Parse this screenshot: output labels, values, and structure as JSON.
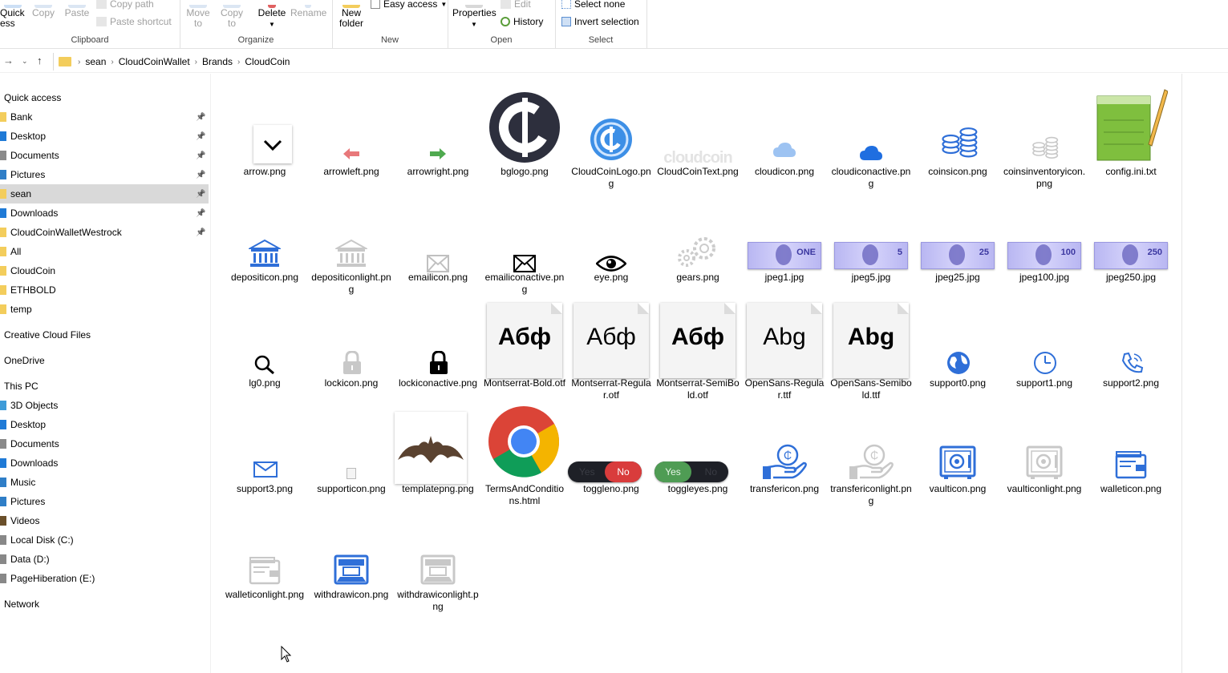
{
  "ribbon": {
    "clipboard": {
      "label": "Clipboard",
      "quick_access": "Quick\ness",
      "copy": "Copy",
      "paste": "Paste",
      "copy_path": "Copy path",
      "paste_shortcut": "Paste shortcut"
    },
    "organize": {
      "label": "Organize",
      "move_to": "Move\nto",
      "copy_to": "Copy\nto",
      "delete": "Delete",
      "rename": "Rename"
    },
    "new": {
      "label": "New",
      "new_folder": "New\nfolder",
      "easy_access": "Easy access"
    },
    "open": {
      "label": "Open",
      "properties": "Properties",
      "edit": "Edit",
      "history": "History"
    },
    "select": {
      "label": "Select",
      "select_none": "Select none",
      "invert_selection": "Invert selection"
    }
  },
  "address": {
    "crumbs": [
      "sean",
      "CloudCoinWallet",
      "Brands",
      "CloudCoin"
    ]
  },
  "sidebar": {
    "items": [
      {
        "label": "Quick access",
        "type": "header"
      },
      {
        "label": "Bank",
        "pinned": true,
        "icon_color": "#f3cd5c"
      },
      {
        "label": "Desktop",
        "pinned": true,
        "icon_color": "#1f7ad6"
      },
      {
        "label": "Documents",
        "pinned": true,
        "icon_color": "#8a8a8a"
      },
      {
        "label": "Pictures",
        "pinned": true,
        "icon_color": "#2f7ec7"
      },
      {
        "label": "sean",
        "pinned": true,
        "selected": true,
        "icon_color": "#f3cd5c"
      },
      {
        "label": "Downloads",
        "pinned": true,
        "icon_color": "#1f7ad6"
      },
      {
        "label": "CloudCoinWalletWestrock",
        "pinned": true,
        "icon_color": "#f3cd5c"
      },
      {
        "label": "All",
        "icon_color": "#f3cd5c"
      },
      {
        "label": "CloudCoin",
        "icon_color": "#f3cd5c"
      },
      {
        "label": "ETHBOLD",
        "icon_color": "#f3cd5c"
      },
      {
        "label": "temp",
        "icon_color": "#f3cd5c"
      },
      {
        "label": "Creative Cloud Files",
        "type": "header"
      },
      {
        "label": "OneDrive",
        "type": "header"
      },
      {
        "label": "This PC",
        "type": "header"
      },
      {
        "label": "3D Objects",
        "icon_color": "#3d9bd8"
      },
      {
        "label": "Desktop",
        "icon_color": "#1f7ad6"
      },
      {
        "label": "Documents",
        "icon_color": "#8a8a8a"
      },
      {
        "label": "Downloads",
        "icon_color": "#1f7ad6"
      },
      {
        "label": "Music",
        "icon_color": "#2f7ec7"
      },
      {
        "label": "Pictures",
        "icon_color": "#2f7ec7"
      },
      {
        "label": "Videos",
        "icon_color": "#6a4f2a"
      },
      {
        "label": "Local Disk (C:)",
        "icon_color": "#888888"
      },
      {
        "label": "Data (D:)",
        "icon_color": "#888888"
      },
      {
        "label": "PageHiberation (E:)",
        "icon_color": "#888888"
      },
      {
        "label": "Network",
        "type": "header"
      }
    ]
  },
  "files": [
    {
      "name": "arrow.png",
      "icon": "chevron-down-icon"
    },
    {
      "name": "arrowleft.png",
      "icon": "arrow-left-icon"
    },
    {
      "name": "arrowright.png",
      "icon": "arrow-right-icon"
    },
    {
      "name": "bglogo.png",
      "icon": "cloudcoin-dark-logo"
    },
    {
      "name": "CloudCoinLogo.png",
      "icon": "cloudcoin-blue-logo"
    },
    {
      "name": "CloudCoinText.png",
      "icon": "cloudcoin-text-logo",
      "logo_text": "cloudcoin"
    },
    {
      "name": "cloudicon.png",
      "icon": "cloud-light-icon"
    },
    {
      "name": "cloudiconactive.png",
      "icon": "cloud-active-icon"
    },
    {
      "name": "coinsicon.png",
      "icon": "coins-icon"
    },
    {
      "name": "coinsinventoryicon.png",
      "icon": "coins-light-icon"
    },
    {
      "name": "config.ini.txt",
      "icon": "notepad-icon"
    },
    {
      "name": "depositicon.png",
      "icon": "bank-icon"
    },
    {
      "name": "depositiconlight.png",
      "icon": "bank-light-icon"
    },
    {
      "name": "emailicon.png",
      "icon": "email-light-icon"
    },
    {
      "name": "emailiconactive.png",
      "icon": "email-icon"
    },
    {
      "name": "eye.png",
      "icon": "eye-icon"
    },
    {
      "name": "gears.png",
      "icon": "gears-icon"
    },
    {
      "name": "jpeg1.jpg",
      "icon": "banknote-image",
      "note": "ONE"
    },
    {
      "name": "jpeg5.jpg",
      "icon": "banknote-image",
      "note": "5"
    },
    {
      "name": "jpeg25.jpg",
      "icon": "banknote-image",
      "note": "25"
    },
    {
      "name": "jpeg100.jpg",
      "icon": "banknote-image",
      "note": "100"
    },
    {
      "name": "jpeg250.jpg",
      "icon": "banknote-image",
      "note": "250"
    },
    {
      "name": "lg0.png",
      "icon": "magnifier-icon"
    },
    {
      "name": "lockicon.png",
      "icon": "lock-light-icon"
    },
    {
      "name": "lockiconactive.png",
      "icon": "lock-icon"
    },
    {
      "name": "Montserrat-Bold.otf",
      "icon": "font-file-icon",
      "sample": "Абф",
      "weight": "bold"
    },
    {
      "name": "Montserrat-Regular.otf",
      "icon": "font-file-icon",
      "sample": "Абф",
      "weight": "normal"
    },
    {
      "name": "Montserrat-SemiBold.otf",
      "icon": "font-file-icon",
      "sample": "Абф",
      "weight": "600"
    },
    {
      "name": "OpenSans-Regular.ttf",
      "icon": "font-file-icon",
      "sample": "Abg",
      "weight": "normal"
    },
    {
      "name": "OpenSans-Semibold.ttf",
      "icon": "font-file-icon",
      "sample": "Abg",
      "weight": "600"
    },
    {
      "name": "support0.png",
      "icon": "globe-icon"
    },
    {
      "name": "support1.png",
      "icon": "clock-icon"
    },
    {
      "name": "support2.png",
      "icon": "phone-icon"
    },
    {
      "name": "support3.png",
      "icon": "envelope-icon"
    },
    {
      "name": "supporticon.png",
      "icon": "tiny-icon"
    },
    {
      "name": "templatepng.png",
      "icon": "bat-image"
    },
    {
      "name": "TermsAndConditions.html",
      "icon": "chrome-icon"
    },
    {
      "name": "toggleno.png",
      "icon": "toggle-no-image",
      "toggle_on": "Yes",
      "toggle_off": "No"
    },
    {
      "name": "toggleyes.png",
      "icon": "toggle-yes-image",
      "toggle_on": "Yes",
      "toggle_off": "No"
    },
    {
      "name": "transfericon.png",
      "icon": "transfer-icon"
    },
    {
      "name": "transfericonlight.png",
      "icon": "transfer-light-icon"
    },
    {
      "name": "vaulticon.png",
      "icon": "vault-icon"
    },
    {
      "name": "vaulticonlight.png",
      "icon": "vault-light-icon"
    },
    {
      "name": "walleticon.png",
      "icon": "wallet-icon"
    },
    {
      "name": "walleticonlight.png",
      "icon": "wallet-light-icon"
    },
    {
      "name": "withdrawicon.png",
      "icon": "withdraw-icon"
    },
    {
      "name": "withdrawiconlight.png",
      "icon": "withdraw-light-icon"
    }
  ],
  "colors": {
    "accent_blue": "#2f6fd8",
    "selection": "#d9d9d9",
    "icon_light": "#c8c8c8"
  }
}
